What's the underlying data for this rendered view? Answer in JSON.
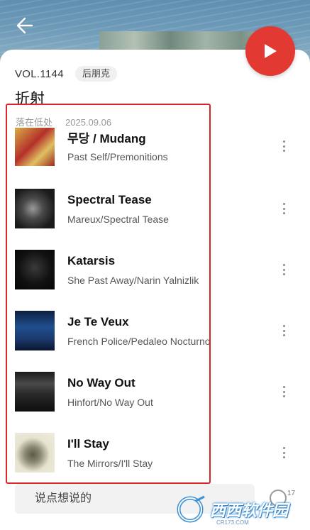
{
  "header": {
    "back_icon": "arrow-left-icon",
    "play_icon": "play-icon",
    "play_color": "#e23a33"
  },
  "playlist": {
    "volume": "VOL.1144",
    "genre_tag": "后朋克",
    "title": "折射",
    "author": "落在低处",
    "date": "2025.09.06"
  },
  "tracks": [
    {
      "name": "무당 / Mudang",
      "artist_album": "Past Self/Premonitions",
      "art_color": "#c9a13b"
    },
    {
      "name": "Spectral Tease",
      "artist_album": "Mareux/Spectral Tease",
      "art_color": "#3a3a3a"
    },
    {
      "name": "Katarsis",
      "artist_album": "She Past Away/Narin Yalnizlik",
      "art_color": "#111111"
    },
    {
      "name": "Je Te Veux",
      "artist_album": "French Police/Pedaleo Nocturno",
      "art_color": "#1e3f7a"
    },
    {
      "name": "No Way Out",
      "artist_album": "Hinfort/No Way Out",
      "art_color": "#2a2a2a"
    },
    {
      "name": "I'll Stay",
      "artist_album": "The Mirrors/I'll Stay",
      "art_color": "#d9d6c2"
    }
  ],
  "footer": {
    "comment_placeholder": "说点想说的",
    "share_count": "17",
    "watermark_text": "西西软件园",
    "watermark_sub": "CR173.COM"
  },
  "colors": {
    "highlight_border": "#d8262b",
    "accent": "#e23a33"
  }
}
